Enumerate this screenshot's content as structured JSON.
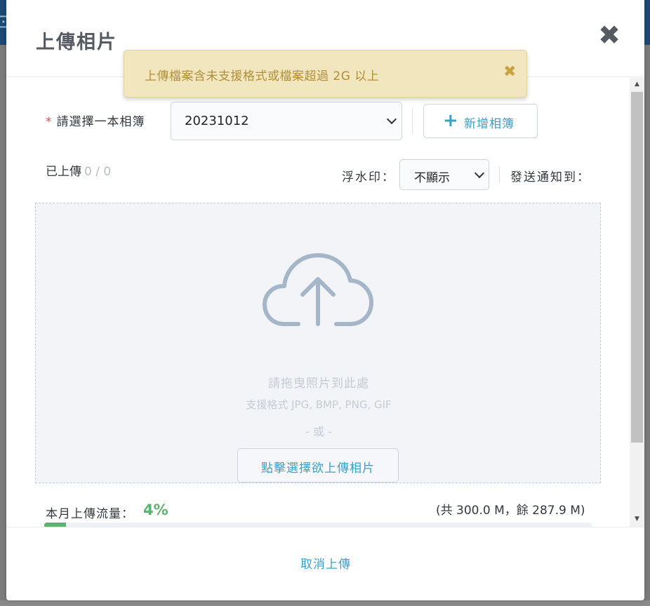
{
  "header": {
    "title": "上傳相片"
  },
  "alert": {
    "message": "上傳檔案含未支援格式或檔案超過 2G 以上"
  },
  "album": {
    "required_mark": "*",
    "label": "請選擇一本相簿",
    "selected": "20231012",
    "add_label": "新增相簿"
  },
  "status": {
    "uploaded_label": "已上傳",
    "uploaded_count": "0 / 0"
  },
  "watermark": {
    "label": "浮水印：",
    "selected": "不顯示"
  },
  "notify": {
    "label": "發送通知到："
  },
  "dropzone": {
    "drop_hint": "請拖曳照片到此處",
    "formats_hint": "支援格式 JPG, BMP, PNG, GIF",
    "or_text": "- 或 -",
    "choose_label": "點擊選擇欲上傳相片"
  },
  "traffic": {
    "label": "本月上傳流量：",
    "percent_text": "4%",
    "percent_value": 4,
    "quota_text": "(共 300.0 M，餘 287.9 M)"
  },
  "footer": {
    "cancel_label": "取消上傳"
  },
  "icons": {
    "close": "close-icon",
    "alert_close": "close-icon",
    "add": "plus-icon",
    "upload": "cloud-upload-icon"
  },
  "colors": {
    "accent": "#3aa0c8",
    "success": "#5cb26e",
    "warning_bg": "#f1e6bd",
    "warning_text": "#b08f3a"
  }
}
